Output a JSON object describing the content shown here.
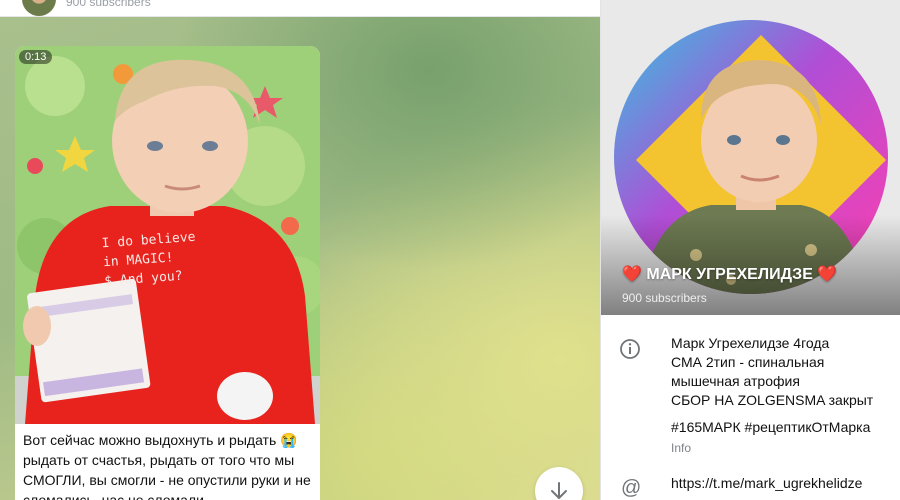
{
  "chat": {
    "header": {
      "subscribers": "900 subscribers"
    },
    "message": {
      "duration": "0:13",
      "shirt_text": [
        "I do believe",
        "in MAGIC!",
        "$ And you?"
      ],
      "caption": [
        "Вот сейчас можно выдохнуть и рыдать 😭",
        " рыдать от счастья, рыдать от того что мы",
        "СМОГЛИ, вы смогли - не опустили руки и не",
        "сломались, нас не сломали ..."
      ]
    },
    "scroll_down_icon": "arrow-down-icon"
  },
  "profile": {
    "name": "❤️ МАРК УГРЕХЕЛИДЗЕ ❤️",
    "subscribers": "900 subscribers",
    "bio_lines": [
      "Марк Угрехелидзе 4года",
      "СМА 2тип - спинальная",
      "мышечная атрофия",
      "СБОР НА ZOLGENSMA закрыт"
    ],
    "hashtags": "#165МАРК #рецептикОтМарка",
    "info_label": "Info",
    "link": "https://t.me/mark_ugrekhelidze",
    "icons": {
      "info": "info-icon",
      "link": "at-icon"
    },
    "colors": {
      "ring_magenta": "#e040c8",
      "ring_cyan": "#34c3e0",
      "diamond": "#f4c430"
    }
  }
}
